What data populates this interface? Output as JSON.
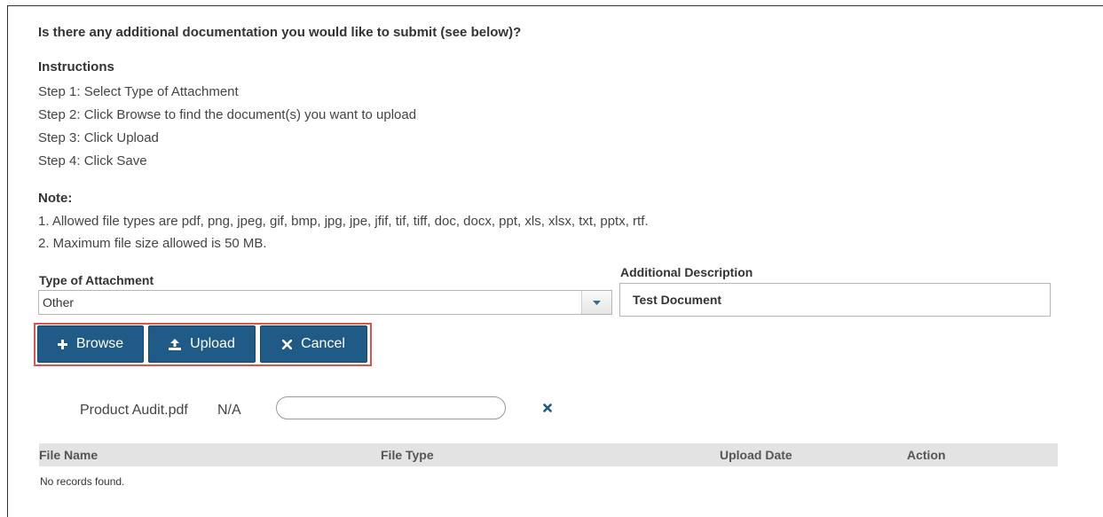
{
  "question": "Is there any additional documentation you would like to submit (see below)?",
  "instructions": {
    "title": "Instructions",
    "steps": [
      "Step 1: Select Type of Attachment",
      "Step 2: Click Browse to find the document(s) you want to upload",
      "Step 3: Click Upload",
      "Step 4: Click Save"
    ]
  },
  "note": {
    "title": "Note:",
    "lines": [
      "1. Allowed file types are pdf, png, jpeg, gif, bmp, jpg, jpe, jfif, tif, tiff, doc, docx, ppt, xls, xlsx, txt, pptx, rtf.",
      "2. Maximum file size allowed is 50 MB."
    ]
  },
  "attachment_type": {
    "label": "Type of Attachment",
    "selected": "Other",
    "arrow_icon": "chevron-down-icon"
  },
  "description": {
    "label": "Additional Description",
    "value": "Test Document"
  },
  "buttons": {
    "browse": {
      "label": "Browse",
      "icon": "plus-icon"
    },
    "upload": {
      "label": "Upload",
      "icon": "upload-icon"
    },
    "cancel": {
      "label": "Cancel",
      "icon": "close-icon"
    },
    "highlight_color": "#d9534f",
    "color": "#1f5b86"
  },
  "pending_file": {
    "name": "Product Audit.pdf",
    "type": "N/A",
    "description": "",
    "remove_icon": "close-icon"
  },
  "table": {
    "columns": [
      "File Name",
      "File Type",
      "Upload Date",
      "Action"
    ],
    "empty_text": "No records found."
  }
}
